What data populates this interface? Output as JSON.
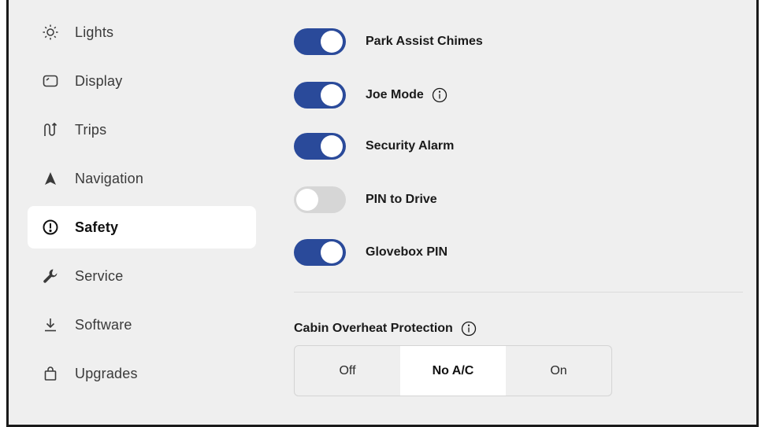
{
  "sidebar": {
    "items": [
      {
        "label": "Lights",
        "icon": "sun-icon",
        "active": false
      },
      {
        "label": "Display",
        "icon": "display-icon",
        "active": false
      },
      {
        "label": "Trips",
        "icon": "trips-icon",
        "active": false
      },
      {
        "label": "Navigation",
        "icon": "navigation-arrow-icon",
        "active": false
      },
      {
        "label": "Safety",
        "icon": "alert-circle-icon",
        "active": true
      },
      {
        "label": "Service",
        "icon": "wrench-icon",
        "active": false
      },
      {
        "label": "Software",
        "icon": "download-icon",
        "active": false
      },
      {
        "label": "Upgrades",
        "icon": "shopping-bag-icon",
        "active": false
      }
    ]
  },
  "toggles": [
    {
      "label": "Park Assist Chimes",
      "on": true,
      "info": false
    },
    {
      "label": "Joe Mode",
      "on": true,
      "info": true
    },
    {
      "label": "Security Alarm",
      "on": true,
      "info": false
    },
    {
      "label": "PIN to Drive",
      "on": false,
      "info": false
    },
    {
      "label": "Glovebox PIN",
      "on": true,
      "info": false
    }
  ],
  "cabin_overheat": {
    "title": "Cabin Overheat Protection",
    "options": [
      "Off",
      "No A/C",
      "On"
    ],
    "selected": "No A/C"
  },
  "colors": {
    "accent": "#2a4a9a",
    "toggle_off": "#d6d6d6",
    "background": "#efefef",
    "active_item": "#ffffff"
  }
}
